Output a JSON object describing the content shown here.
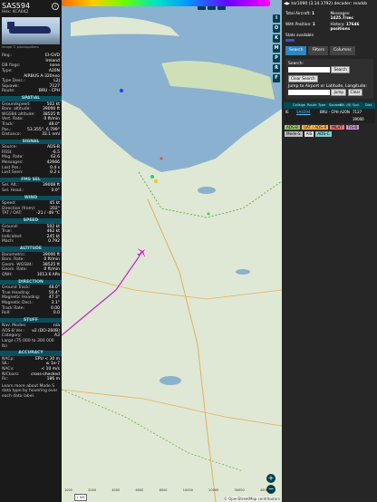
{
  "sidebar": {
    "callsign": "SAS594",
    "hex": "Hex: 4CA042",
    "photo_credit": "Image © planespotters",
    "close_icon": "close-icon",
    "details": [
      {
        "k": "Reg.:",
        "v": "EI-GVD"
      },
      {
        "k": "",
        "v": "Ireland"
      },
      {
        "k": "DB flags:",
        "v": "none"
      },
      {
        "k": "Type:",
        "v": "A20N"
      },
      {
        "k": "",
        "v": "AIRBUS A-320neo"
      },
      {
        "k": "Type Desc.:",
        "v": "L2J"
      },
      {
        "k": "Squawk:",
        "v": "7127"
      },
      {
        "k": "Route:",
        "v": "BRU - CPH"
      }
    ],
    "sections": [
      {
        "title": "SPATIAL",
        "rows": [
          {
            "k": "Groundspeed:",
            "v": "502 kt"
          },
          {
            "k": "Baro. altitude:",
            "v": "39000 ft"
          },
          {
            "k": "WGS84 altitude:",
            "v": "38525 ft"
          },
          {
            "k": "Vert. Rate:",
            "v": "0 ft/min"
          },
          {
            "k": "Track:",
            "v": "48.0°"
          },
          {
            "k": "Pos.:",
            "v": "53.355°, 6.799°"
          },
          {
            "k": "Distance:",
            "v": "33.1 nmi"
          }
        ]
      },
      {
        "title": "SIGNAL",
        "rows": [
          {
            "k": "Source:",
            "v": "ADS-B"
          },
          {
            "k": "RSSI:",
            "v": "-6.5"
          },
          {
            "k": "Msg. Rate:",
            "v": "62.6"
          },
          {
            "k": "Messages:",
            "v": "42666"
          },
          {
            "k": "Last Pos.:",
            "v": "0.4 s"
          },
          {
            "k": "Last Seen:",
            "v": "0.2 s"
          }
        ]
      },
      {
        "title": "FMS SEL",
        "rows": [
          {
            "k": "Sel. Alt.:",
            "v": "39008 ft"
          },
          {
            "k": "Sel. Head.:",
            "v": "0.0°"
          }
        ]
      },
      {
        "title": "WIND",
        "rows": [
          {
            "k": "Speed:",
            "v": "45 kt"
          },
          {
            "k": "Direction (from):",
            "v": "202°"
          },
          {
            "k": "TAT / OAT:",
            "v": "-21 / -49 °C"
          }
        ]
      },
      {
        "title": "SPEED",
        "rows": [
          {
            "k": "Ground:",
            "v": "502 kt"
          },
          {
            "k": "True:",
            "v": "462 kt"
          },
          {
            "k": "Indicated:",
            "v": "245 kt"
          },
          {
            "k": "Mach:",
            "v": "0.792"
          }
        ]
      },
      {
        "title": "ALTITUDE",
        "rows": [
          {
            "k": "Barometric:",
            "v": "39000 ft"
          },
          {
            "k": "Baro. Rate:",
            "v": "0 ft/min"
          },
          {
            "k": "Geom. WGS84:",
            "v": "38525 ft"
          },
          {
            "k": "Geom. Rate:",
            "v": "0 ft/min"
          },
          {
            "k": "QNH:",
            "v": "1013.6 hPa"
          }
        ]
      },
      {
        "title": "DIRECTION",
        "rows": [
          {
            "k": "Ground Track:",
            "v": "48.0°"
          },
          {
            "k": "True Heading:",
            "v": "50.4°"
          },
          {
            "k": "Magnetic Heading:",
            "v": "47.3°"
          },
          {
            "k": "Magnetic Decl.:",
            "v": "3.1°"
          },
          {
            "k": "Track Rate:",
            "v": "0.00"
          },
          {
            "k": "Roll:",
            "v": "0.0"
          }
        ]
      },
      {
        "title": "STUFF",
        "rows": [
          {
            "k": "Nav. Modes:",
            "v": "n/a"
          },
          {
            "k": "ADS-B Ver.:",
            "v": "v2 (DO-260B)"
          },
          {
            "k": "Category:",
            "v": "A3"
          },
          {
            "k": "Large (75 000 to 300 000 lb)",
            "v": ""
          }
        ]
      },
      {
        "title": "ACCURACY",
        "rows": [
          {
            "k": "NACp:",
            "v": "EPU < 30 m"
          },
          {
            "k": "SIL:",
            "v": "≤ 1e-7"
          },
          {
            "k": "NACv:",
            "v": "< 10 m/s"
          },
          {
            "k": "NICbaro:",
            "v": "cross-checked"
          },
          {
            "k": "Rc:",
            "v": "186 m"
          }
        ]
      }
    ],
    "footer": "Learn more about Mode S data type by hovering over each data label."
  },
  "map": {
    "top_buttons": [
      "U",
      "H",
      "T"
    ],
    "side_buttons": [
      "I",
      "O",
      "K",
      "M",
      "P",
      "R",
      "F"
    ],
    "zoom_in": "+",
    "zoom_out": "−",
    "scale_labels": [
      "1000",
      "2000",
      "4000",
      "6000",
      "8000",
      "10000",
      "20000",
      "30000",
      "40000+"
    ],
    "small_button": "1 NM",
    "attribution": "© OpenStreetMap contributors",
    "colors": {
      "water": "#8ab1cf",
      "land": "#dfe8d4",
      "trail": "#c223c9",
      "route": "#6ab04c"
    }
  },
  "right": {
    "version_label": "tar1090",
    "version_number": "(3.14.1792) decoder:",
    "version_link": "readsb",
    "stats": [
      {
        "k": "Total Aircraft:",
        "v": "1"
      },
      {
        "k": "Messages:",
        "v": "1425.7/sec"
      },
      {
        "k": "With Position:",
        "v": "1"
      },
      {
        "k": "History:",
        "v": "17646 positions"
      },
      {
        "k": "Stats available",
        "v": ""
      }
    ],
    "tabs": [
      "Search",
      "Filters",
      "Columns"
    ],
    "search_label": "Search:",
    "search_button": "Search",
    "clear_search_button": "Clear Search",
    "jump_label": "Jump to Airport or Latitude, Longitude:",
    "jump_button": "Jump",
    "clear_button": "Clear",
    "table_headers": [
      "",
      "Callsign",
      "Route",
      "Type",
      "Squawk",
      "Alt. (ft)",
      "Spd.",
      "Dist."
    ],
    "table_rows": [
      {
        "flag": "IE",
        "callsign": "SAS594",
        "route": "BRU - CPH",
        "type": "A20N",
        "squawk": "7127",
        "alt": "39000"
      }
    ],
    "legend": [
      {
        "label": "ADS-B",
        "color": "#9ccc65"
      },
      {
        "label": "UAT / ADS-R",
        "color": "#ffb74d"
      },
      {
        "label": "MLAT",
        "color": "#e57373"
      },
      {
        "label": "TIS-B",
        "color": "#ce93d8"
      },
      {
        "label": "Mode-S",
        "color": "#bdbdbd"
      },
      {
        "label": "AIS",
        "color": "#e0e0e0"
      },
      {
        "label": "ADS-C",
        "color": "#80cbc4"
      }
    ]
  }
}
